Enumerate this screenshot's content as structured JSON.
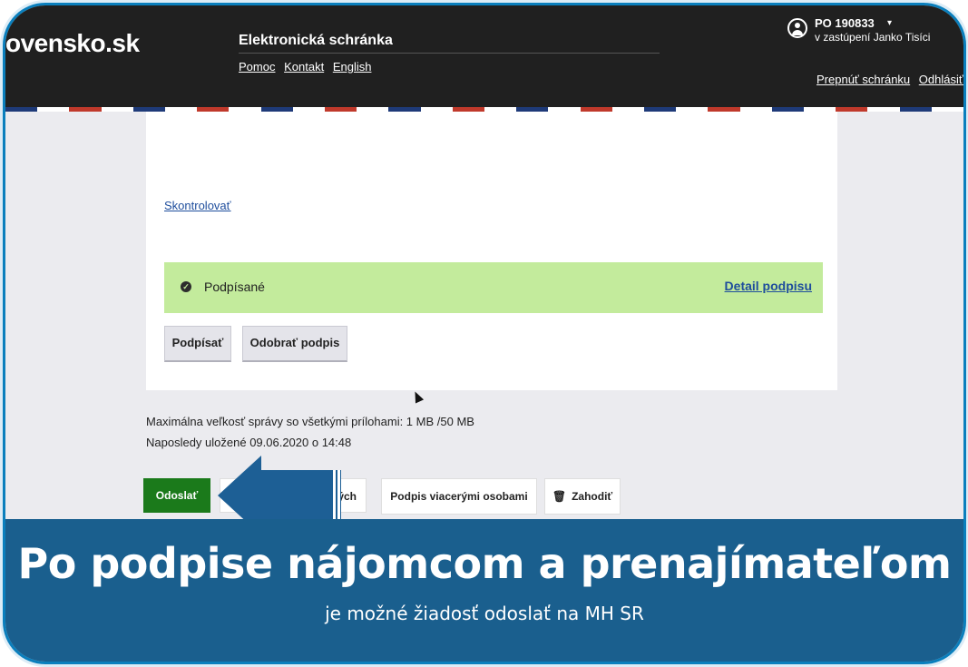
{
  "header": {
    "logo": "ovensko.sk",
    "service_title": "Elektronická schránka",
    "links": [
      "Pomoc",
      "Kontakt",
      "English"
    ],
    "user_id": "PO 190833",
    "user_caret": "▾",
    "user_repr": "v zastúpení Janko Tisíci",
    "right_links": [
      "Prepnúť schránku",
      "Odhlásiť sa"
    ]
  },
  "stripe_colors": [
    "#1e3a78",
    "#ffffff",
    "#c0392b",
    "#ffffff"
  ],
  "card": {
    "check_link": "Skontrolovať",
    "signed_status": "Podpísané",
    "detail_link": "Detail podpisu",
    "check_icon": "check-circle-icon",
    "buttons": {
      "sign": "Podpísať",
      "unsign": "Odobrať podpis"
    }
  },
  "info": {
    "size": "Maximálna veľkosť správy so všetkými prílohami: 1 MB /50 MB",
    "saved": "Naposledy uložené 09.06.2020 o 14:48"
  },
  "actions": {
    "send": "Odoslať",
    "hidden_partial": "ných",
    "multi_sign": "Podpis viacerými osobami",
    "discard_icon": "🗑",
    "discard": "Zahodiť"
  },
  "banner": {
    "title": "Po podpise nájomcom a prenajímateľom",
    "subtitle": "je možné žiadosť odoslať na MH SR"
  },
  "colors": {
    "top_bar": "#202020",
    "signed_bg": "#c3eb9c",
    "send_btn": "#1b7a1b",
    "banner": "#1a5f8e",
    "arrow": "#1d5f95",
    "link": "#1e4d9c"
  }
}
